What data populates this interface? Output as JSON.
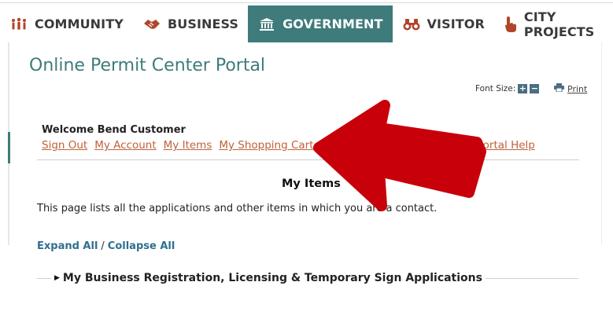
{
  "nav": {
    "items": [
      {
        "label": "COMMUNITY",
        "icon": "people-icon"
      },
      {
        "label": "BUSINESS",
        "icon": "handshake-icon"
      },
      {
        "label": "GOVERNMENT",
        "icon": "building-icon",
        "active": true
      },
      {
        "label": "VISITOR",
        "icon": "binoculars-icon"
      },
      {
        "label": "CITY PROJECTS",
        "icon": "hand-pointer-icon"
      }
    ],
    "active_color": "#3f7b7b"
  },
  "page": {
    "title": "Online Permit Center Portal",
    "font_size_label": "Font Size:",
    "font_increase": "+",
    "font_decrease": "−",
    "print_label": "Print"
  },
  "account": {
    "welcome": "Welcome Bend Customer",
    "links": [
      "Sign Out",
      "My Account",
      "My Items",
      "My Shopping Cart (1)"
    ],
    "help": "Portal Help"
  },
  "content": {
    "heading": "My Items",
    "description": "This page lists all the applications and other items in which you are a contact.",
    "expand_all": "Expand All",
    "separator": "/",
    "collapse_all": "Collapse All",
    "section_label": "My Business Registration, Licensing & Temporary Sign Applications"
  },
  "annotation": {
    "arrow_color": "#c8000a"
  }
}
